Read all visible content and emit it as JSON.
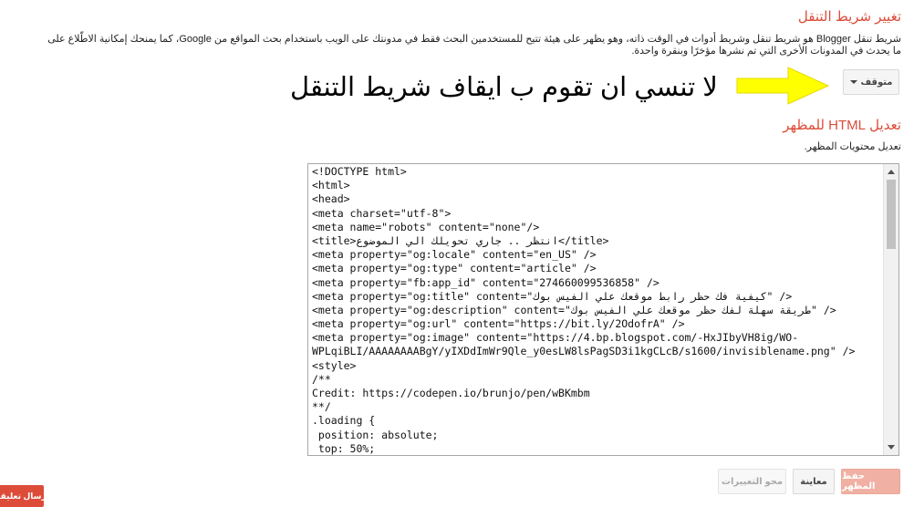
{
  "navbar": {
    "title": "تغيير شريط التنقل",
    "description": "شريط تنقل Blogger هو شريط تنقل وشريط أدوات في الوقت ذاته، وهو يظهر على هيئة تتيح للمستخدمين البحث فقط في مدونتك على الويب باستخدام بحث المواقع من Google، كما يمنحك إمكانية الاطّلاع على ما يحدث في المدونات الأخرى التي تم نشرها مؤخرًا وبنقرة واحدة.",
    "dropdown_label": "متوقف"
  },
  "annotation": {
    "text": "لا تنسي ان تقوم ب ايقاف شريط التنقل",
    "arrow_color": "#ffff00"
  },
  "html_editor": {
    "title": "تعديل HTML للمظهر",
    "description": "تعديل محتويات المظهر.",
    "code_lines": [
      "<!DOCTYPE html>",
      "<html>",
      "<head>",
      "<meta charset=\"utf-8\">",
      "<meta name=\"robots\" content=\"none\"/>",
      "<title>انتظر .. جاري تحويلك الي الموضوع</title>",
      "<meta property=\"og:locale\" content=\"en_US\" />",
      "<meta property=\"og:type\" content=\"article\" />",
      "<meta property=\"fb:app_id\" content=\"274660099536858\" />",
      "<meta property=\"og:title\" content=\"كيفية فك حظر رابط موقعك علي الفيس بوك\" />",
      "<meta property=\"og:description\" content=\"طريقة سهلة لفك حظر موقعك علي الفيس بوك\" />",
      "<meta property=\"og:url\" content=\"https://bit.ly/2OdofrA\" />",
      "<meta property=\"og:image\" content=\"https://4.bp.blogspot.com/-HxJIbyVH8ig/WO-",
      "WPLqiBLI/AAAAAAAABgY/yIXDdImWr9Qle_y0esLW8lsPagSD3i1kgCLcB/s1600/invisiblename.png\" />",
      "<style>",
      "/**",
      "Credit: https://codepen.io/brunjo/pen/wBKmbm",
      "**/",
      ".loading {",
      " position: absolute;",
      " top: 50%;"
    ]
  },
  "buttons": {
    "save": "حفظ المظهر",
    "preview": "معاينة",
    "clear": "محو التغييرات",
    "feedback": "إرسال تعليقات"
  },
  "colors": {
    "accent": "#dd4b39",
    "save_disabled": "#f0b0a3"
  }
}
